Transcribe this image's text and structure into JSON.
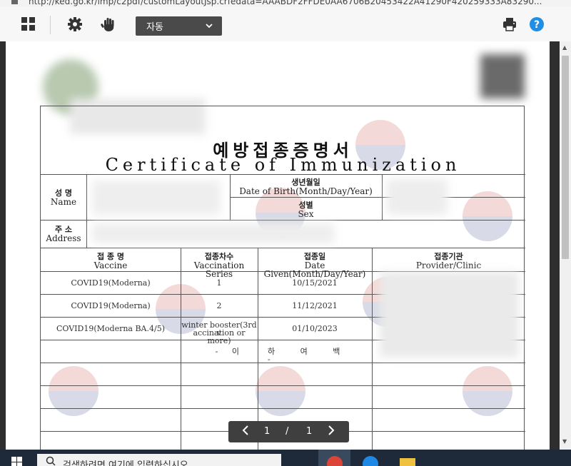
{
  "browser": {
    "url": "http://ked.go.kr/imp/c2pdf/customLayoutJsp.crfedata=AAABDF2FFDE0AA6706B20453422A41290F420259333A83290..."
  },
  "toolbar": {
    "zoom_value": "자동",
    "icons": [
      "grid-icon",
      "gear-icon",
      "hand-icon",
      "printer-icon",
      "help-icon"
    ]
  },
  "document": {
    "title_ko": "예방접종증명서",
    "title_en": "Certificate of Immunization",
    "labels": {
      "name_ko": "성 명",
      "name_en": "Name",
      "dob_ko": "생년월일",
      "dob_en": "Date of Birth(Month/Day/Year)",
      "sex_ko": "성별",
      "sex_en": "Sex",
      "address_ko": "주 소",
      "address_en": "Address"
    },
    "table": {
      "headers": [
        {
          "ko": "접 종 명",
          "en": "Vaccine"
        },
        {
          "ko": "접종차수",
          "en": "Vaccination Series"
        },
        {
          "ko": "접종일",
          "en": "Date Given(Month/Day/Year)"
        },
        {
          "ko": "접종기관",
          "en": "Provider/Clinic"
        }
      ],
      "rows": [
        {
          "vaccine": "COVID19(Moderna)",
          "series": "1",
          "date": "10/15/2021"
        },
        {
          "vaccine": "COVID19(Moderna)",
          "series": "2",
          "date": "11/12/2021"
        },
        {
          "vaccine": "COVID19(Moderna BA.4/5)",
          "series_line1": "winter booster(3rd v",
          "series_line2": "accination or more)",
          "date": "01/10/2023"
        }
      ],
      "end_mark_left": "- 이",
      "end_mark_right": "하 여 백 -"
    }
  },
  "pager": {
    "current": "1",
    "separator": "/",
    "total": "1"
  },
  "taskbar": {
    "search_text": "검색하려면 여기에 입력하십시오"
  }
}
